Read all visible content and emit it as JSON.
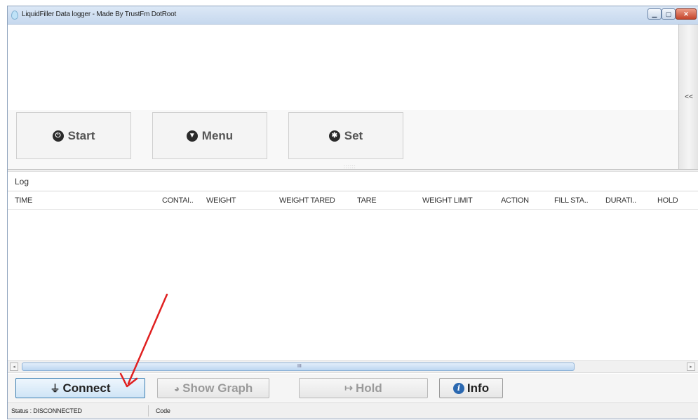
{
  "window": {
    "title": "LiquidFiller Data logger - Made By TrustFm DotRoot"
  },
  "top_panel": {
    "collapse_label": "<<",
    "buttons": [
      {
        "label": "Start",
        "icon": "power-icon"
      },
      {
        "label": "Menu",
        "icon": "down-circle-icon"
      },
      {
        "label": "Set",
        "icon": "settings-circle-icon"
      }
    ]
  },
  "log": {
    "label": "Log",
    "columns": [
      "TIME",
      "CONTAI..",
      "WEIGHT",
      "WEIGHT TARED",
      "TARE",
      "WEIGHT LIMIT",
      "ACTION",
      "FILL STA..",
      "DURATI..",
      "HOLD"
    ],
    "rows": []
  },
  "toolbar": {
    "connect_label": "Connect",
    "show_graph_label": "Show Graph",
    "hold_label": "Hold",
    "info_label": "Info"
  },
  "status": {
    "status_text": "Status : DISCONNECTED",
    "code_text": "Code"
  },
  "colors": {
    "annotation_arrow": "#e02020",
    "connect_border": "#3c7fb1",
    "info_icon": "#2b68b0"
  }
}
